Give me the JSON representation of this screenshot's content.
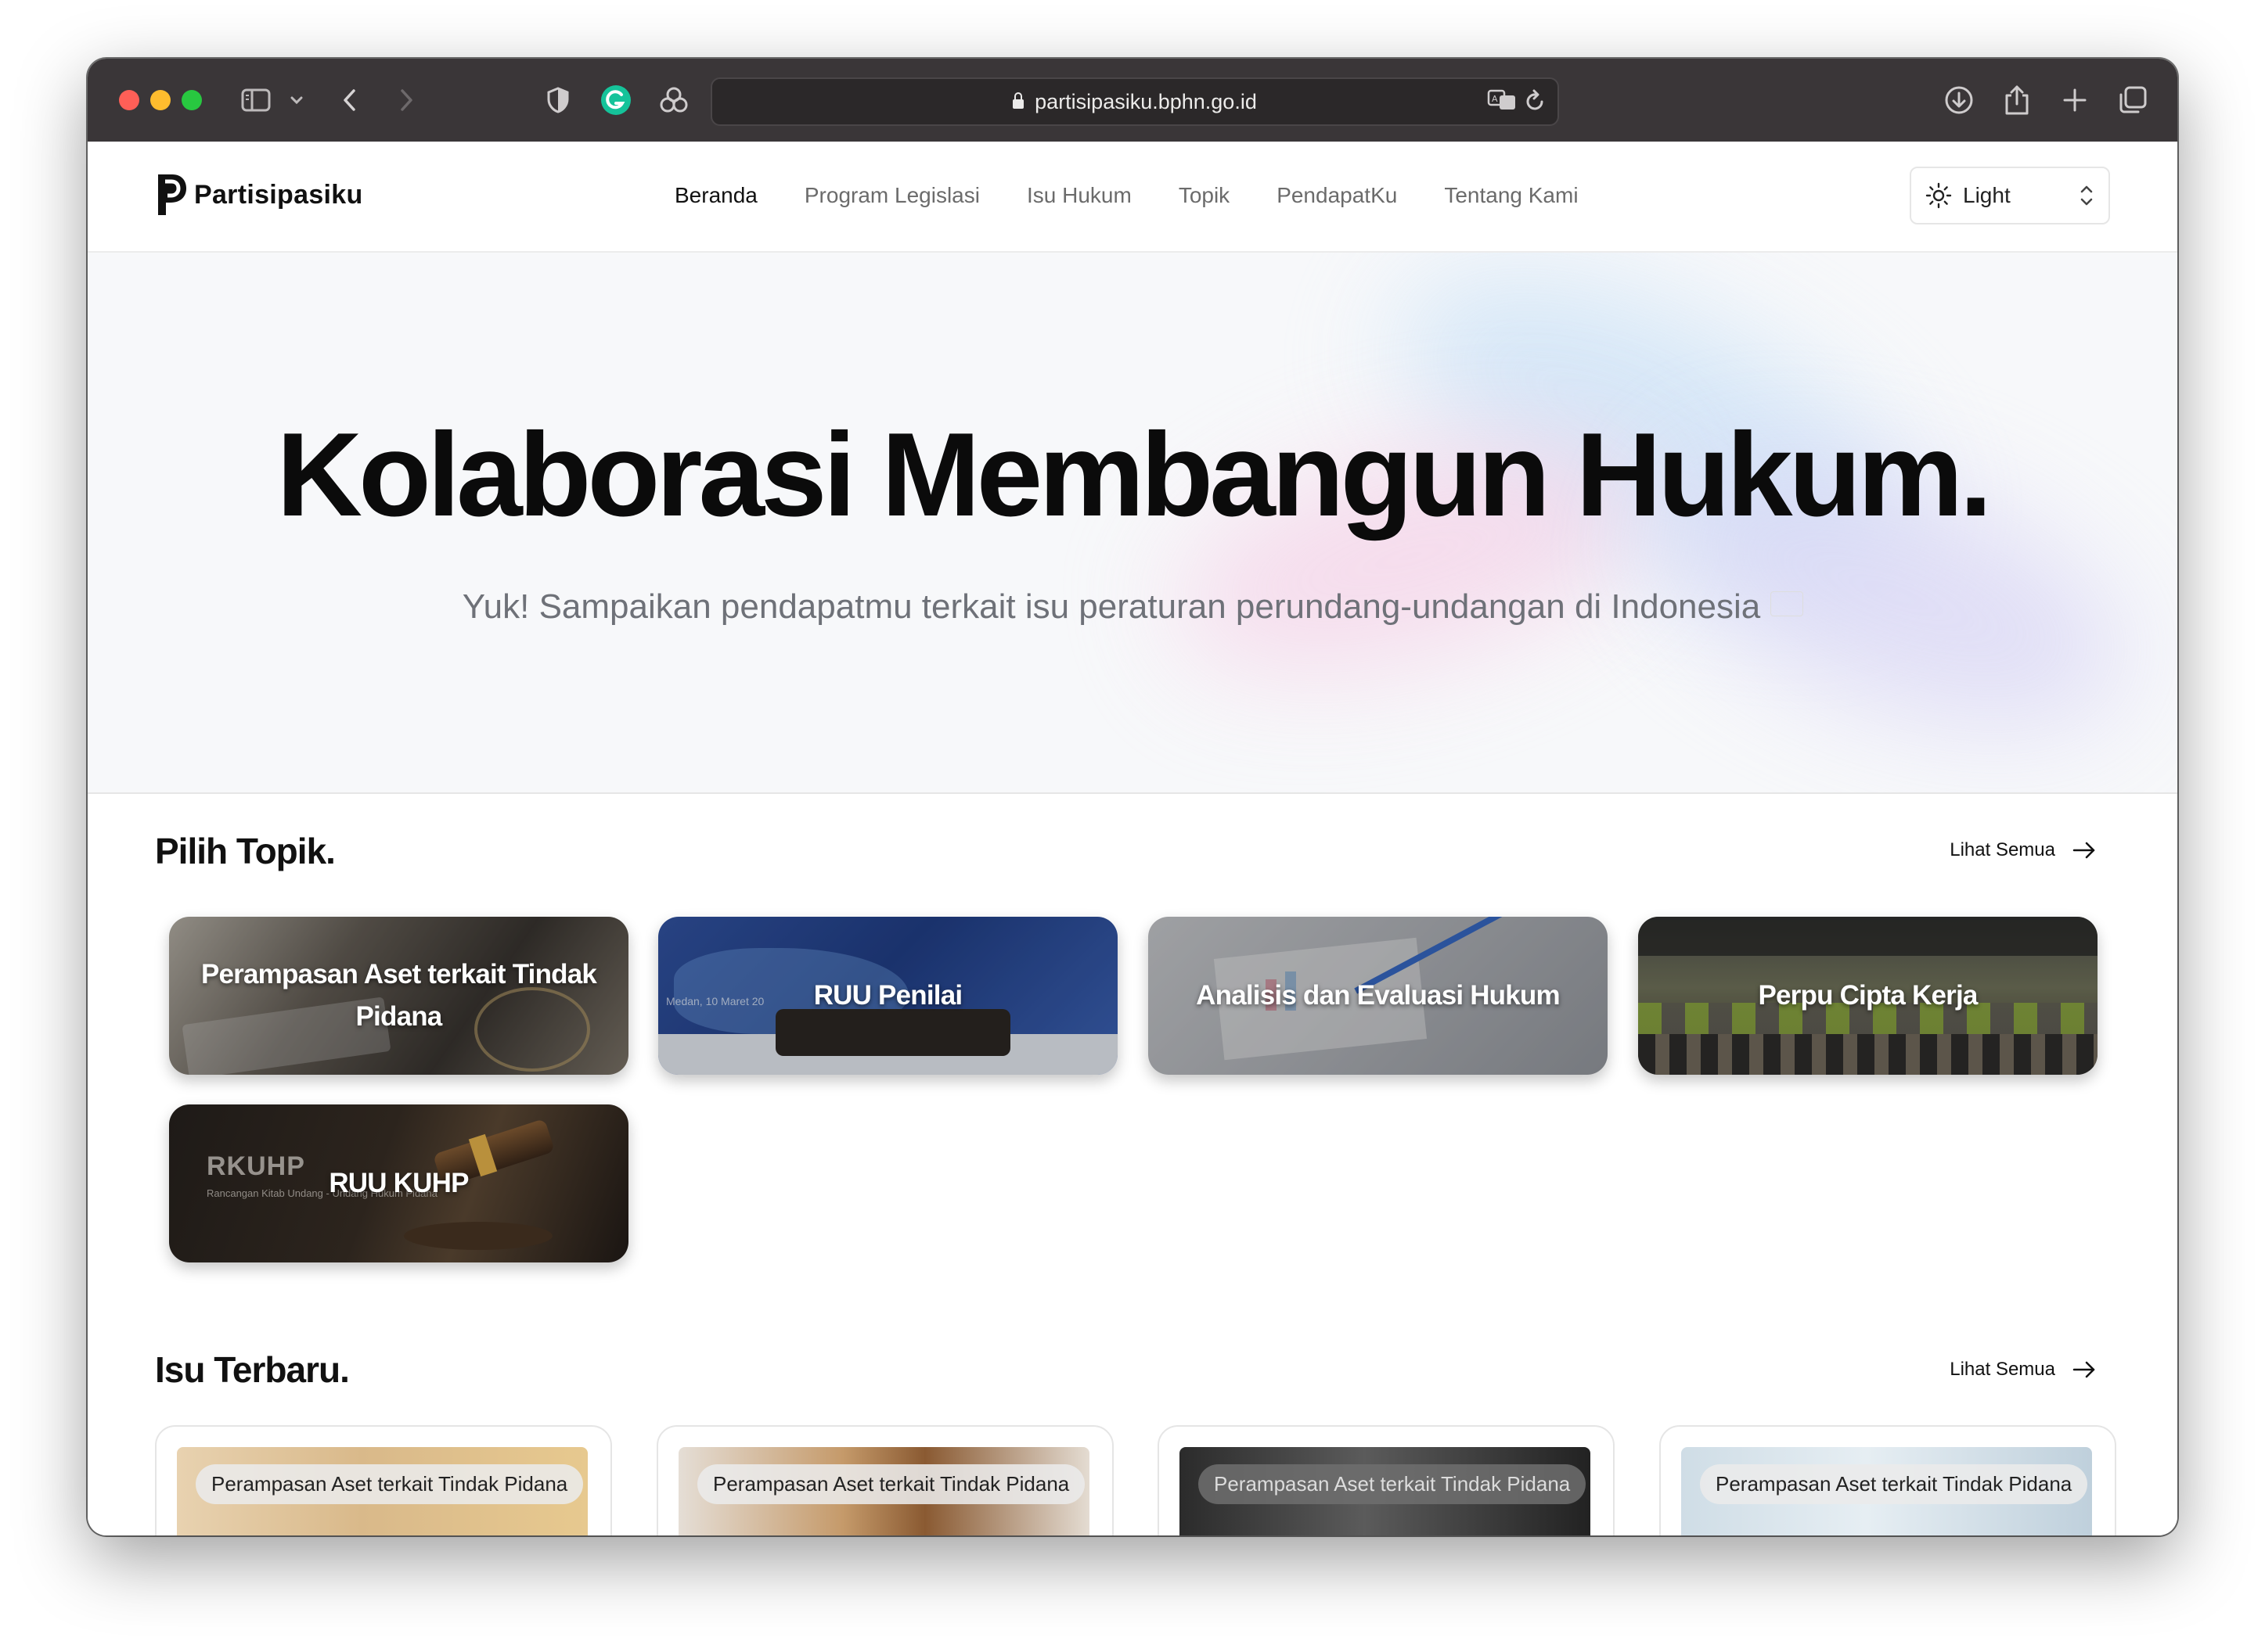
{
  "browser": {
    "url": "partisipasiku.bphn.go.id"
  },
  "site": {
    "logo_text": "Partisipasiku",
    "nav": [
      {
        "label": "Beranda"
      },
      {
        "label": "Program Legislasi"
      },
      {
        "label": "Isu Hukum"
      },
      {
        "label": "Topik"
      },
      {
        "label": "PendapatKu"
      },
      {
        "label": "Tentang Kami"
      }
    ],
    "theme_value": "Light"
  },
  "hero": {
    "title": "Kolaborasi Membangun Hukum.",
    "subtitle": "Yuk! Sampaikan pendapatmu terkait isu peraturan perundang-undangan di Indonesia"
  },
  "topics": {
    "title": "Pilih Topik.",
    "see_all": "Lihat Semua",
    "cards": [
      {
        "label": "Perampasan Aset terkait Tindak Pidana"
      },
      {
        "label": "RUU Penilai"
      },
      {
        "label": "Analisis dan Evaluasi Hukum"
      },
      {
        "label": "Perpu Cipta Kerja"
      },
      {
        "label": "RUU KUHP"
      }
    ],
    "card_decor_text": {
      "ruu_penilai": "Medan, 10 Maret 20",
      "rkuhp_logo": "RKUHP",
      "rkuhp_tagline": "Rancangan Kitab Undang - Undang Hukum Pidana"
    }
  },
  "issues": {
    "title": "Isu Terbaru.",
    "see_all": "Lihat Semua",
    "cards": [
      {
        "badge": "Perampasan Aset terkait Tindak Pidana"
      },
      {
        "badge": "Perampasan Aset terkait Tindak Pidana"
      },
      {
        "badge": "Perampasan Aset terkait Tindak Pidana"
      },
      {
        "badge": "Perampasan Aset terkait Tindak Pidana"
      }
    ]
  },
  "colors": {
    "titlebar": "#3a3638",
    "close": "#ff5f57",
    "minimize": "#febc2e",
    "zoom": "#28c840",
    "grammarly": "#15c39a"
  }
}
